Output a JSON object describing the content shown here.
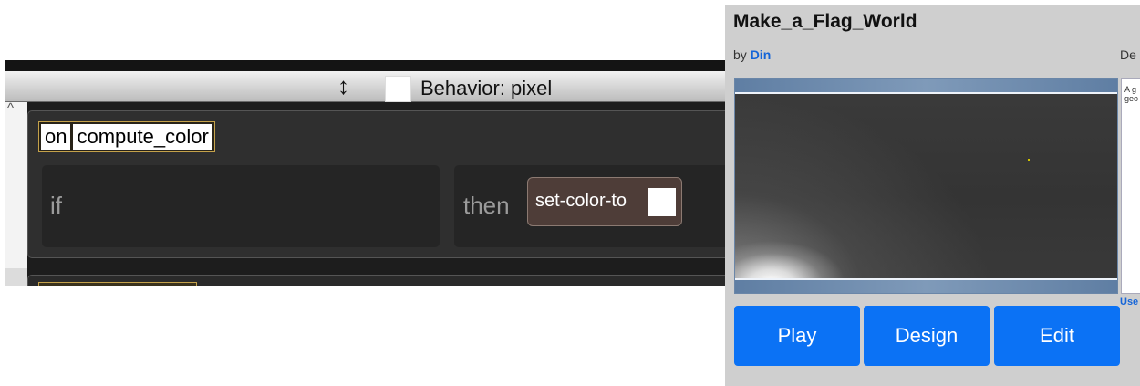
{
  "editor": {
    "behavior_title": "Behavior: pixel",
    "resize_icon_glyph": "↕",
    "scroll_up_glyph": "^",
    "rule": {
      "trigger_keyword": "on",
      "trigger_event": "compute_color",
      "if_label": "if",
      "then_label": "then",
      "action_label": "set-color-to"
    }
  },
  "card": {
    "title": "Make_a_Flag_World",
    "by_prefix": "by",
    "author": "Din",
    "description_label": "De",
    "side_text": "A g geo",
    "use_link": "Use",
    "buttons": {
      "play": "Play",
      "design": "Design",
      "edit": "Edit"
    },
    "button_color": "#0b72f5"
  }
}
